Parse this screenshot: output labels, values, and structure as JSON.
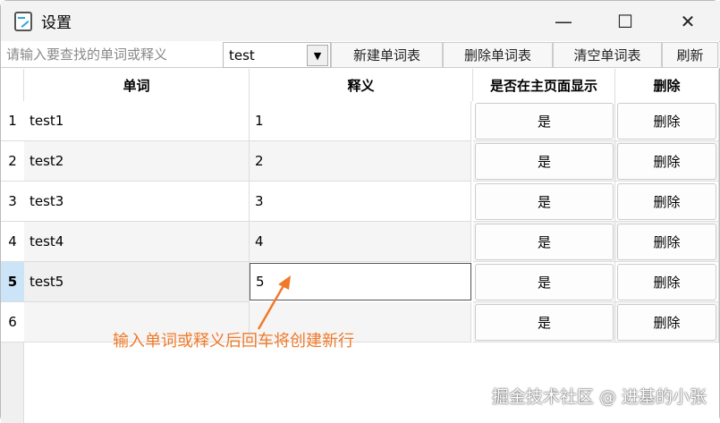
{
  "window": {
    "title": "设置",
    "minimize": "—",
    "maximize": "☐",
    "close": "✕"
  },
  "toolbar": {
    "search_placeholder": "请输入要查找的单词或释义",
    "wordbook": "test",
    "new": "新建单词表",
    "delete": "删除单词表",
    "clear": "清空单词表",
    "refresh": "刷新"
  },
  "table": {
    "headers": [
      "单词",
      "释义",
      "是否在主页面显示",
      "删除"
    ],
    "rows": [
      {
        "n": "1",
        "word": "test1",
        "meaning": "1",
        "show": "是",
        "del": "删除"
      },
      {
        "n": "2",
        "word": "test2",
        "meaning": "2",
        "show": "是",
        "del": "删除"
      },
      {
        "n": "3",
        "word": "test3",
        "meaning": "3",
        "show": "是",
        "del": "删除"
      },
      {
        "n": "4",
        "word": "test4",
        "meaning": "4",
        "show": "是",
        "del": "删除"
      },
      {
        "n": "5",
        "word": "test5",
        "meaning": "5",
        "show": "是",
        "del": "删除"
      },
      {
        "n": "6",
        "word": "",
        "meaning": "",
        "show": "是",
        "del": "删除"
      }
    ]
  },
  "annotation": "输入单词或释义后回车将创建新行",
  "watermark": "掘金技术社区 @ 进基的小张"
}
